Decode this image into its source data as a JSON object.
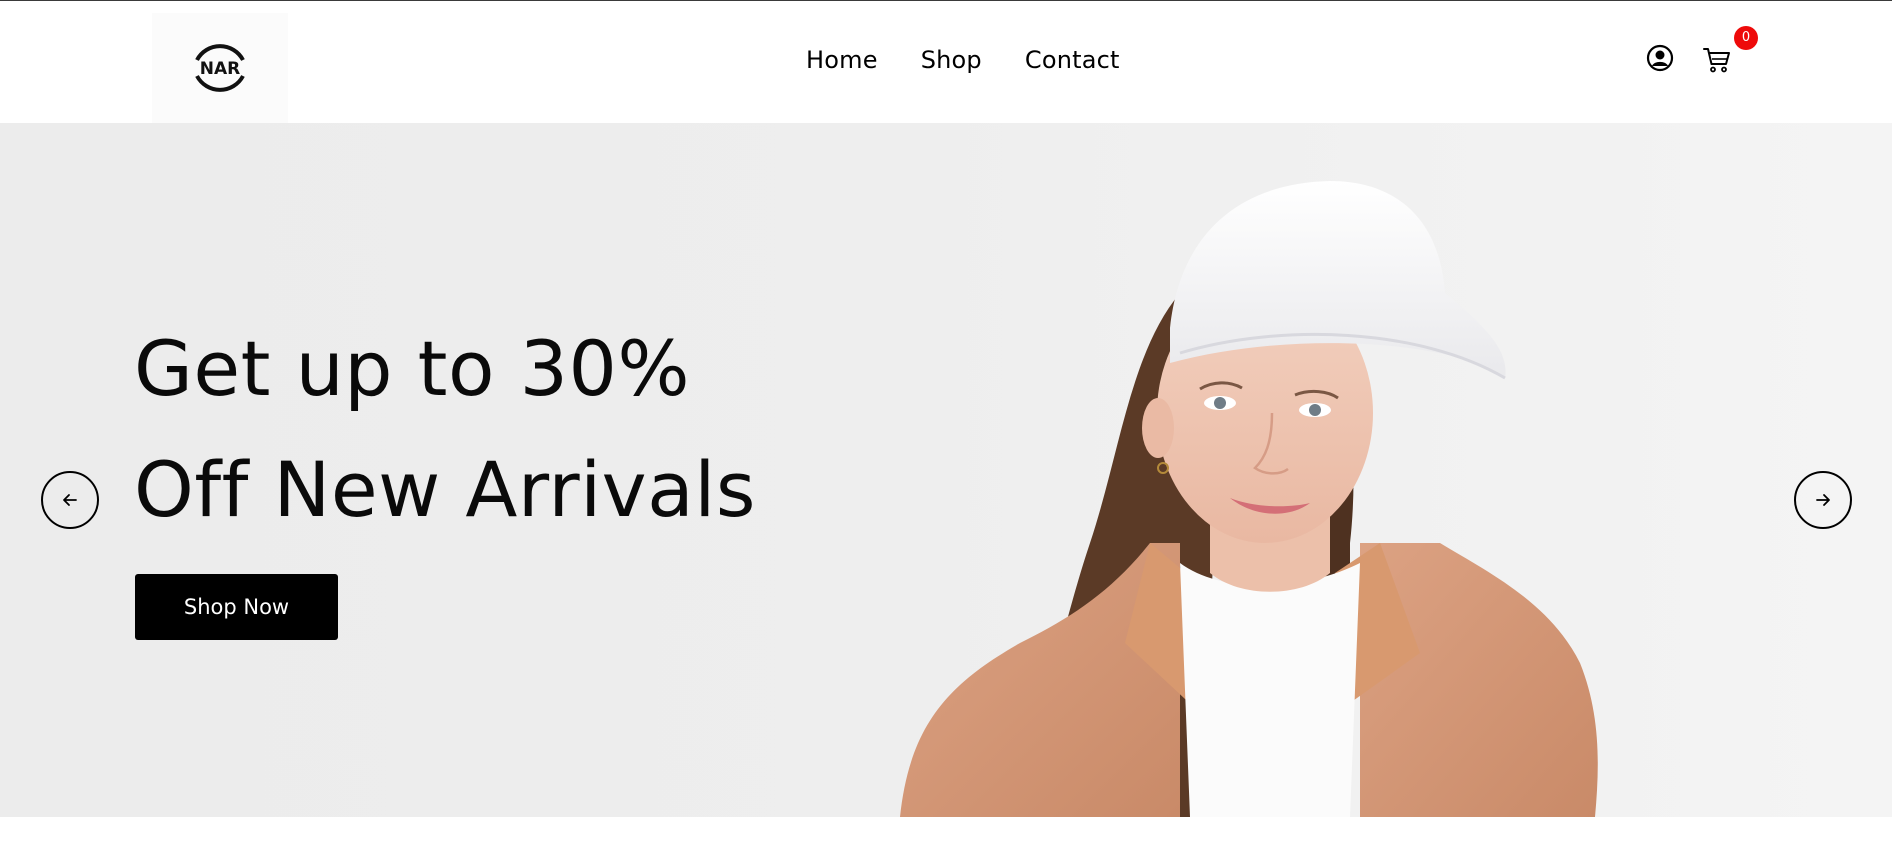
{
  "brand": {
    "logo_text": "NAR",
    "logo_icon": "circle-ring-logo-icon"
  },
  "nav": {
    "items": [
      {
        "label": "Home"
      },
      {
        "label": "Shop"
      },
      {
        "label": "Contact"
      }
    ]
  },
  "header_actions": {
    "account_icon": "user-circle-icon",
    "cart_icon": "shopping-cart-icon",
    "cart_count": "0"
  },
  "hero": {
    "headline_line1": "Get up to 30%",
    "headline_line2": "Off New Arrivals",
    "cta_label": "Shop Now",
    "prev_icon": "arrow-left-icon",
    "next_icon": "arrow-right-icon",
    "image": "model-white-cap-peach-jacket-photo"
  },
  "colors": {
    "badge": "#ee0a0a",
    "hero_bg": "#eeeeee",
    "cta_bg": "#000000",
    "jacket": "#d49a78"
  }
}
